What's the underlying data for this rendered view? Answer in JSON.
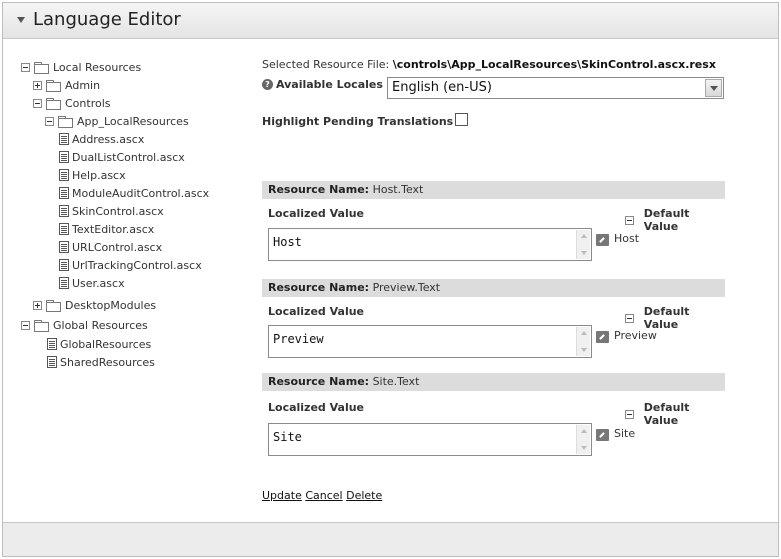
{
  "module": {
    "title": "Language Editor"
  },
  "tree": {
    "items": [
      {
        "label": "Local Resources",
        "toggle": "minus",
        "icon": "folder"
      },
      {
        "label": "Admin",
        "toggle": "plus",
        "icon": "folder"
      },
      {
        "label": "Controls",
        "toggle": "minus",
        "icon": "folder"
      },
      {
        "label": "App_LocalResources",
        "toggle": "minus",
        "icon": "folder"
      },
      {
        "label": "Address.ascx",
        "icon": "document"
      },
      {
        "label": "DualListControl.ascx",
        "icon": "document"
      },
      {
        "label": "Help.ascx",
        "icon": "document"
      },
      {
        "label": "ModuleAuditControl.ascx",
        "icon": "document"
      },
      {
        "label": "SkinControl.ascx",
        "icon": "document"
      },
      {
        "label": "TextEditor.ascx",
        "icon": "document"
      },
      {
        "label": "URLControl.ascx",
        "icon": "document"
      },
      {
        "label": "UrlTrackingControl.ascx",
        "icon": "document"
      },
      {
        "label": "User.ascx",
        "icon": "document"
      },
      {
        "label": "DesktopModules",
        "toggle": "plus",
        "icon": "folder"
      },
      {
        "label": "Global Resources",
        "toggle": "minus",
        "icon": "folder"
      },
      {
        "label": "GlobalResources",
        "icon": "document"
      },
      {
        "label": "SharedResources",
        "icon": "document"
      }
    ]
  },
  "editor": {
    "selected_file_label": "Selected Resource File:",
    "selected_file_value": "\\controls\\App_LocalResources\\SkinControl.ascx.resx",
    "locales_label": "Available Locales",
    "locale_selected": "English (en-US)",
    "highlight_label": "Highlight Pending Translations",
    "highlight_checked": false
  },
  "resources": [
    {
      "name_label": "Resource Name:",
      "name": "Host.Text",
      "localized_label": "Localized Value",
      "localized_value": "Host",
      "default_label": "Default Value",
      "default_value": "Host"
    },
    {
      "name_label": "Resource Name:",
      "name": "Preview.Text",
      "localized_label": "Localized Value",
      "localized_value": "Preview",
      "default_label": "Default Value",
      "default_value": "Preview"
    },
    {
      "name_label": "Resource Name:",
      "name": "Site.Text",
      "localized_label": "Localized Value",
      "localized_value": "Site",
      "default_label": "Default Value",
      "default_value": "Site"
    }
  ],
  "actions": {
    "update": "Update",
    "cancel": "Cancel",
    "delete": "Delete"
  }
}
